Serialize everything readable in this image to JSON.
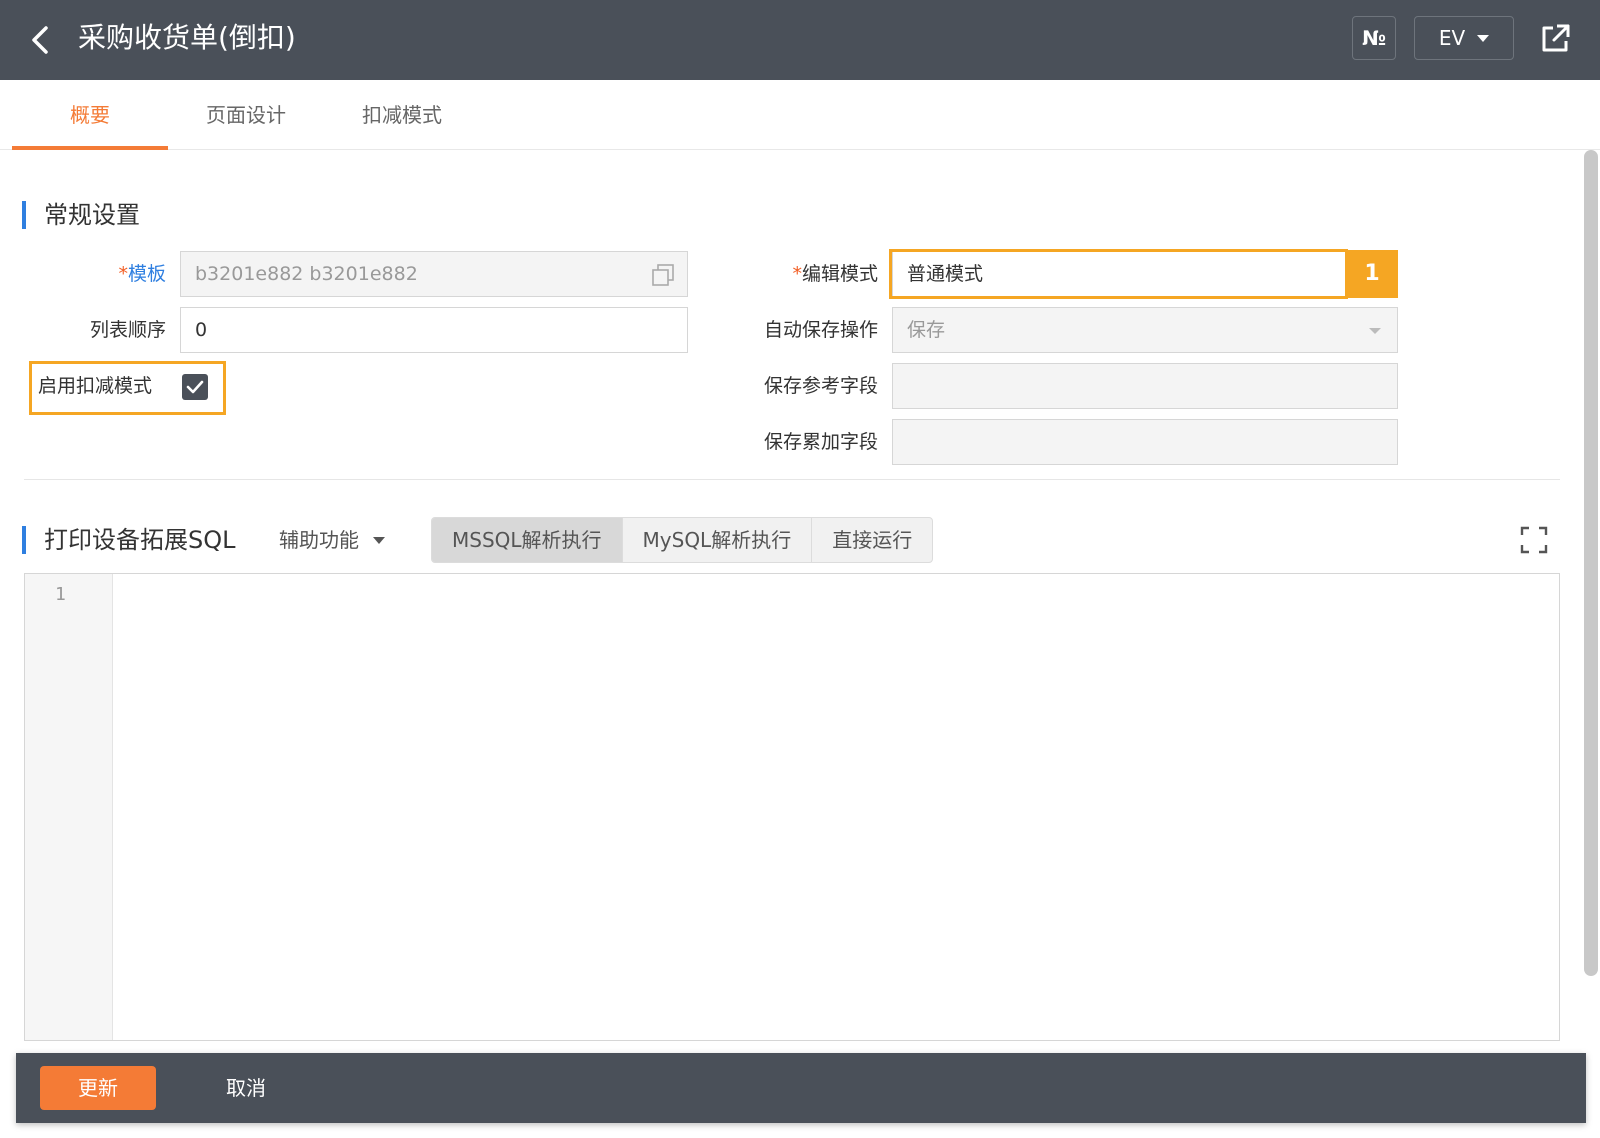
{
  "header": {
    "title": "采购收货单(倒扣)",
    "number_button": "№",
    "lang_button": "EV",
    "icons": [
      "back-arrow-icon",
      "external-link-icon",
      "caret-down-icon"
    ]
  },
  "tabs": [
    {
      "label": "概要",
      "active": true
    },
    {
      "label": "页面设计",
      "active": false
    },
    {
      "label": "扣减模式",
      "active": false
    }
  ],
  "general": {
    "section_title": "常规设置",
    "template_label": "模板",
    "template_value": "b3201e882 b3201e882",
    "list_order_label": "列表顺序",
    "list_order_value": "0",
    "deduct_mode_label": "启用扣减模式",
    "deduct_mode_checked": true,
    "edit_mode_label": "编辑模式",
    "edit_mode_value": "普通模式",
    "edit_mode_badge": "1",
    "auto_save_label": "自动保存操作",
    "auto_save_value": "保存",
    "save_ref_label": "保存参考字段",
    "save_ref_value": "",
    "save_accum_label": "保存累加字段",
    "save_accum_value": "",
    "required_mark": "*"
  },
  "sql": {
    "section_title": "打印设备拓展SQL",
    "assist_label": "辅助功能",
    "modes": [
      {
        "label": "MSSQL解析执行",
        "active": true
      },
      {
        "label": "MySQL解析执行",
        "active": false
      },
      {
        "label": "直接运行",
        "active": false
      }
    ],
    "line_numbers": [
      "1"
    ]
  },
  "footer": {
    "update_label": "更新",
    "cancel_label": "取消"
  },
  "colors": {
    "accent": "#f47b36",
    "highlight": "#f5a623",
    "topbar": "#4a5059",
    "section_bar": "#2f7fe0"
  }
}
